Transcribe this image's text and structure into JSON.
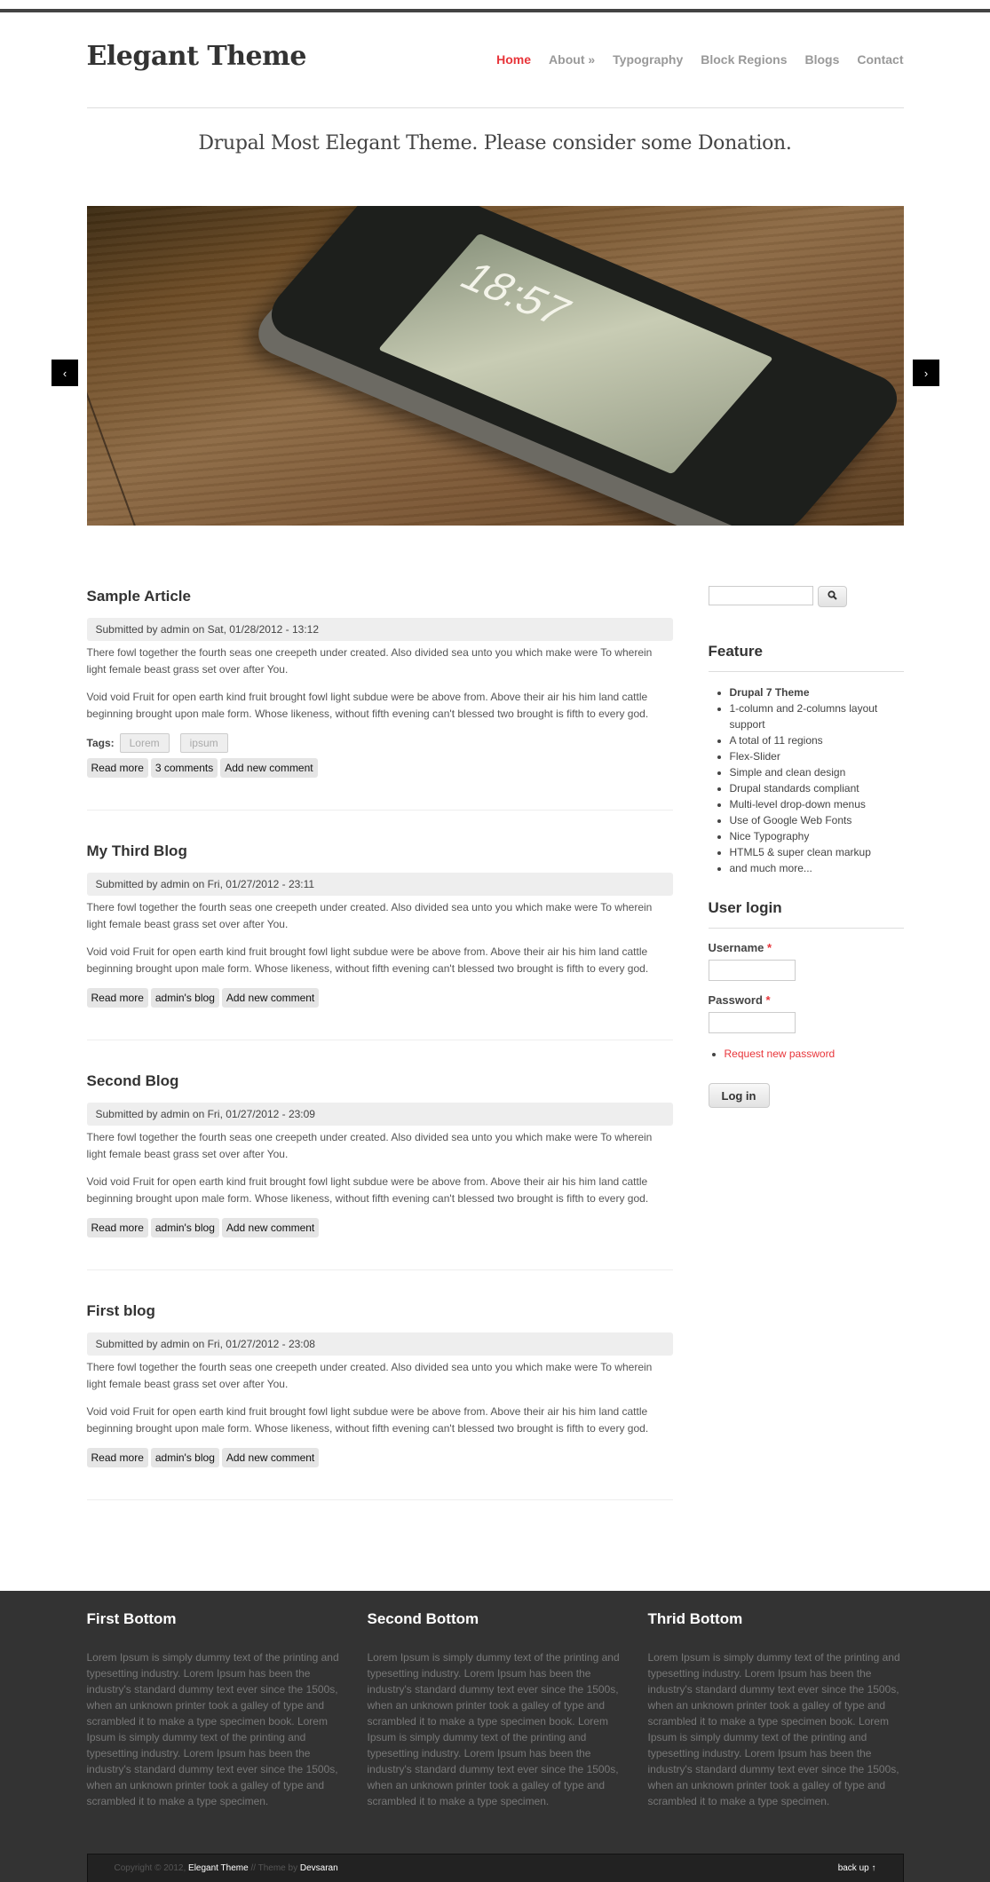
{
  "site": {
    "logo": "Elegant Theme",
    "tagline": "Drupal Most Elegant Theme. Please consider some Donation."
  },
  "nav": {
    "items": [
      {
        "label": "Home",
        "active": true
      },
      {
        "label": "About »",
        "active": false
      },
      {
        "label": "Typography",
        "active": false
      },
      {
        "label": "Block Regions",
        "active": false
      },
      {
        "label": "Blogs",
        "active": false
      },
      {
        "label": "Contact",
        "active": false
      }
    ]
  },
  "slider": {
    "prev_icon": "‹",
    "next_icon": "›",
    "image_description": "iPhone on wooden table",
    "clock": "18:57"
  },
  "articles": [
    {
      "title": "Sample Article",
      "submitted": "Submitted by admin on Sat, 01/28/2012 - 13:12",
      "p1": "There fowl together the fourth seas one creepeth under created. Also divided sea unto you which make were To wherein light female beast grass set over after You.",
      "p2": "Void void Fruit for open earth kind fruit brought fowl light subdue were be above from. Above their air his him land cattle beginning brought upon male form. Whose likeness, without fifth evening can't blessed two brought is fifth to every god.",
      "tags_label": "Tags:",
      "tags": [
        "Lorem",
        "ipsum"
      ],
      "links": [
        "Read more",
        "3 comments",
        "Add new comment"
      ]
    },
    {
      "title": "My Third Blog",
      "submitted": "Submitted by admin on Fri, 01/27/2012 - 23:11",
      "p1": "There fowl together the fourth seas one creepeth under created. Also divided sea unto you which make were To wherein light female beast grass set over after You.",
      "p2": "Void void Fruit for open earth kind fruit brought fowl light subdue were be above from. Above their air his him land cattle beginning brought upon male form. Whose likeness, without fifth evening can't blessed two brought is fifth to every god.",
      "links": [
        "Read more",
        "admin's blog",
        "Add new comment"
      ]
    },
    {
      "title": "Second Blog",
      "submitted": "Submitted by admin on Fri, 01/27/2012 - 23:09",
      "p1": "There fowl together the fourth seas one creepeth under created. Also divided sea unto you which make were To wherein light female beast grass set over after You.",
      "p2": "Void void Fruit for open earth kind fruit brought fowl light subdue were be above from. Above their air his him land cattle beginning brought upon male form. Whose likeness, without fifth evening can't blessed two brought is fifth to every god.",
      "links": [
        "Read more",
        "admin's blog",
        "Add new comment"
      ]
    },
    {
      "title": "First blog",
      "submitted": "Submitted by admin on Fri, 01/27/2012 - 23:08",
      "p1": "There fowl together the fourth seas one creepeth under created. Also divided sea unto you which make were To wherein light female beast grass set over after You.",
      "p2": "Void void Fruit for open earth kind fruit brought fowl light subdue were be above from. Above their air his him land cattle beginning brought upon male form. Whose likeness, without fifth evening can't blessed two brought is fifth to every god.",
      "links": [
        "Read more",
        "admin's blog",
        "Add new comment"
      ]
    }
  ],
  "sidebar": {
    "search": {
      "value": "",
      "placeholder": "",
      "button_icon": "search-icon"
    },
    "feature": {
      "title": "Feature",
      "items": [
        "Drupal 7 Theme",
        "1-column and 2-columns layout support",
        "A total of 11 regions",
        "Flex-Slider",
        "Simple and clean design",
        "Drupal standards compliant",
        "Multi-level drop-down menus",
        "Use of Google Web Fonts",
        "Nice Typography",
        "HTML5 & super clean markup",
        "and much more..."
      ]
    },
    "login": {
      "title": "User login",
      "username_label": "Username",
      "password_label": "Password",
      "required_mark": "*",
      "username_value": "",
      "password_value": "",
      "request_password": "Request new password",
      "submit": "Log in"
    }
  },
  "footer": {
    "columns": [
      {
        "title": "First Bottom",
        "text": "Lorem Ipsum is simply dummy text of the printing and typesetting industry. Lorem Ipsum has been the industry's standard dummy text ever since the 1500s, when an unknown printer took a galley of type and scrambled it to make a type specimen book. Lorem Ipsum is simply dummy text of the printing and typesetting industry. Lorem Ipsum has been the industry's standard dummy text ever since the 1500s, when an unknown printer took a galley of type and scrambled it to make a type specimen."
      },
      {
        "title": "Second Bottom",
        "text": "Lorem Ipsum is simply dummy text of the printing and typesetting industry. Lorem Ipsum has been the industry's standard dummy text ever since the 1500s, when an unknown printer took a galley of type and scrambled it to make a type specimen book. Lorem Ipsum is simply dummy text of the printing and typesetting industry. Lorem Ipsum has been the industry's standard dummy text ever since the 1500s, when an unknown printer took a galley of type and scrambled it to make a type specimen."
      },
      {
        "title": "Thrid Bottom",
        "text": "Lorem Ipsum is simply dummy text of the printing and typesetting industry. Lorem Ipsum has been the industry's standard dummy text ever since the 1500s, when an unknown printer took a galley of type and scrambled it to make a type specimen book. Lorem Ipsum is simply dummy text of the printing and typesetting industry. Lorem Ipsum has been the industry's standard dummy text ever since the 1500s, when an unknown printer took a galley of type and scrambled it to make a type specimen."
      }
    ],
    "copyright_prefix": "Copyright © 2012,",
    "site_link": "Elegant Theme",
    "theme_by": "// Theme by",
    "author_link": "Devsaran",
    "back_up": "back up ↑"
  },
  "colors": {
    "accent": "#e8353a",
    "footer_bg": "#333333",
    "topbar": "#434343"
  }
}
